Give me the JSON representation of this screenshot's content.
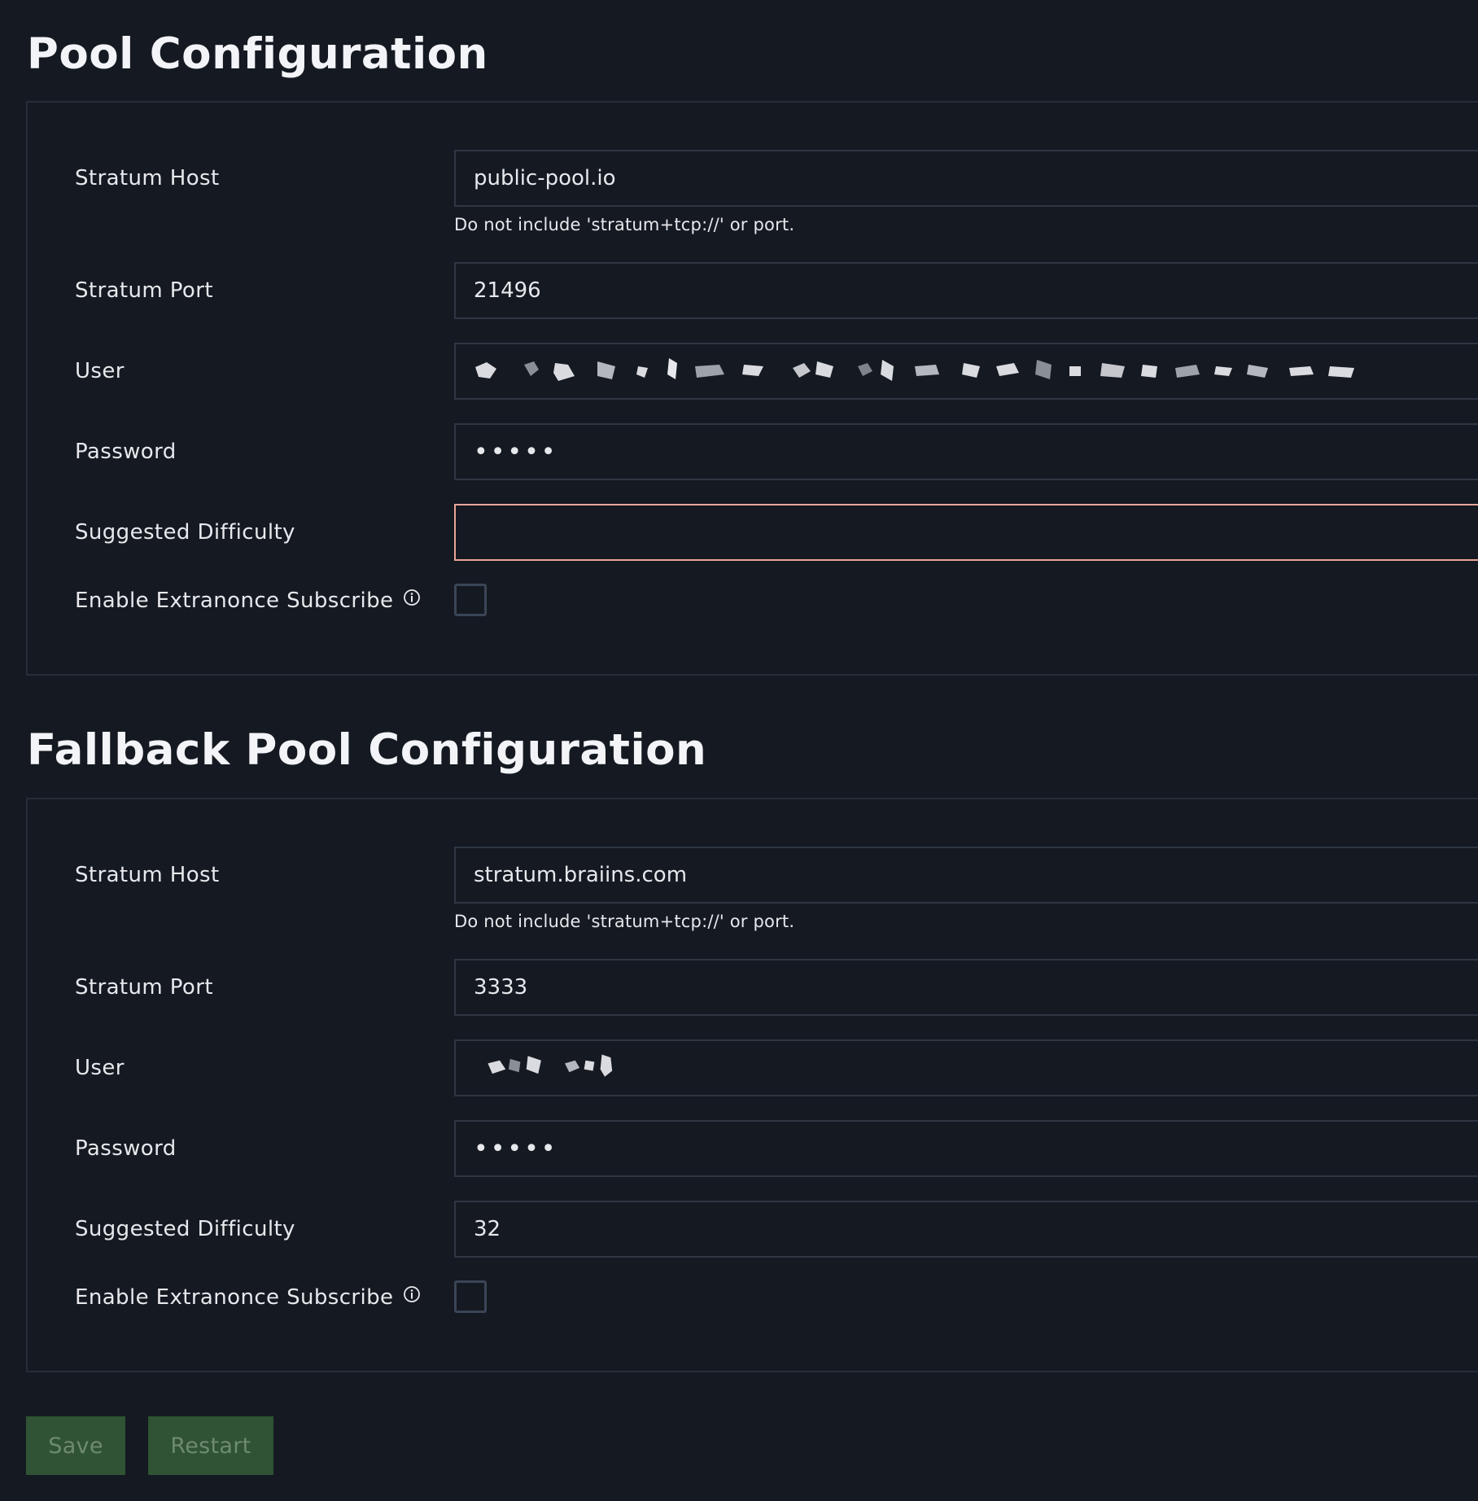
{
  "pool": {
    "title": "Pool Configuration",
    "stratum_host": {
      "label": "Stratum Host",
      "value": "public-pool.io",
      "hint": "Do not include 'stratum+tcp://' or port."
    },
    "stratum_port": {
      "label": "Stratum Port",
      "value": "21496"
    },
    "user": {
      "label": "User"
    },
    "password": {
      "label": "Password",
      "value": "•••••"
    },
    "suggested_difficulty": {
      "label": "Suggested Difficulty",
      "value": ""
    },
    "extranonce": {
      "label": "Enable Extranonce Subscribe",
      "checked": false
    }
  },
  "fallback": {
    "title": "Fallback Pool Configuration",
    "stratum_host": {
      "label": "Stratum Host",
      "value": "stratum.braiins.com",
      "hint": "Do not include 'stratum+tcp://' or port."
    },
    "stratum_port": {
      "label": "Stratum Port",
      "value": "3333"
    },
    "user": {
      "label": "User"
    },
    "password": {
      "label": "Password",
      "value": "•••••"
    },
    "suggested_difficulty": {
      "label": "Suggested Difficulty",
      "value": "32"
    },
    "extranonce": {
      "label": "Enable Extranonce Subscribe",
      "checked": false
    }
  },
  "buttons": {
    "save": "Save",
    "restart": "Restart"
  },
  "icons": {
    "info": "info-circle-icon"
  },
  "colors": {
    "background": "#151921",
    "border": "#2e3643",
    "error_border": "#e8a598",
    "button_bg": "#2f5334",
    "button_text": "#6f8a72"
  }
}
